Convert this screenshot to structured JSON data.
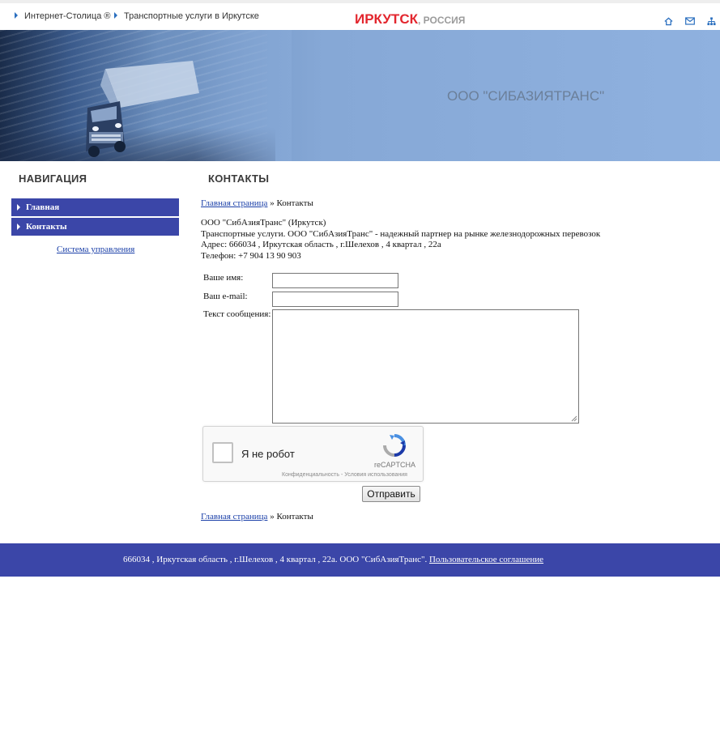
{
  "top": {
    "crumbs": [
      "Интернет-Столица ®",
      "Транспортные услуги в Иркутске"
    ],
    "city": "ИРКУТСК",
    "country": ", РОССИЯ",
    "icons": [
      "home-icon",
      "mail-icon",
      "sitemap-icon"
    ]
  },
  "banner": {
    "company": "ООО \"СИБАЗИЯТРАНС\""
  },
  "nav": {
    "heading": "НАВИГАЦИЯ",
    "items": [
      "Главная",
      "Контакты"
    ],
    "cms_link": "Система управления"
  },
  "content": {
    "heading": "КОНТАКТЫ",
    "breadcrumb_link": "Главная страница",
    "breadcrumb_sep": " » ",
    "breadcrumb_current": "Контакты",
    "info": [
      "ООО \"СибАзияТранс\" (Иркутск)",
      "Транспортные услуги. ООО \"СибАзияТранс\" - надежный партнер на рынке железнодорожных перевозок",
      "Адрес: 666034 , Иркутская область , г.Шелехов , 4 квартал , 22а",
      "Телефон: +7 904 13 90 903"
    ]
  },
  "form": {
    "name_label": "Ваше имя:",
    "email_label": "Ваш e-mail:",
    "message_label": "Текст сообщения:",
    "name_value": "",
    "email_value": "",
    "message_value": "",
    "submit_label": "Отправить"
  },
  "captcha": {
    "label": "Я не робот",
    "brand": "reCAPTCHA",
    "terms": "Конфиденциальность - Условия использования"
  },
  "footer": {
    "text": "666034 , Иркутская область , г.Шелехов , 4 квартал , 22а. ООО \"СибАзияТранс\". ",
    "link": "Пользовательское соглашение"
  },
  "colors": {
    "accent": "#3b46a8",
    "city": "#e3262e",
    "link": "#1a3fa8"
  }
}
